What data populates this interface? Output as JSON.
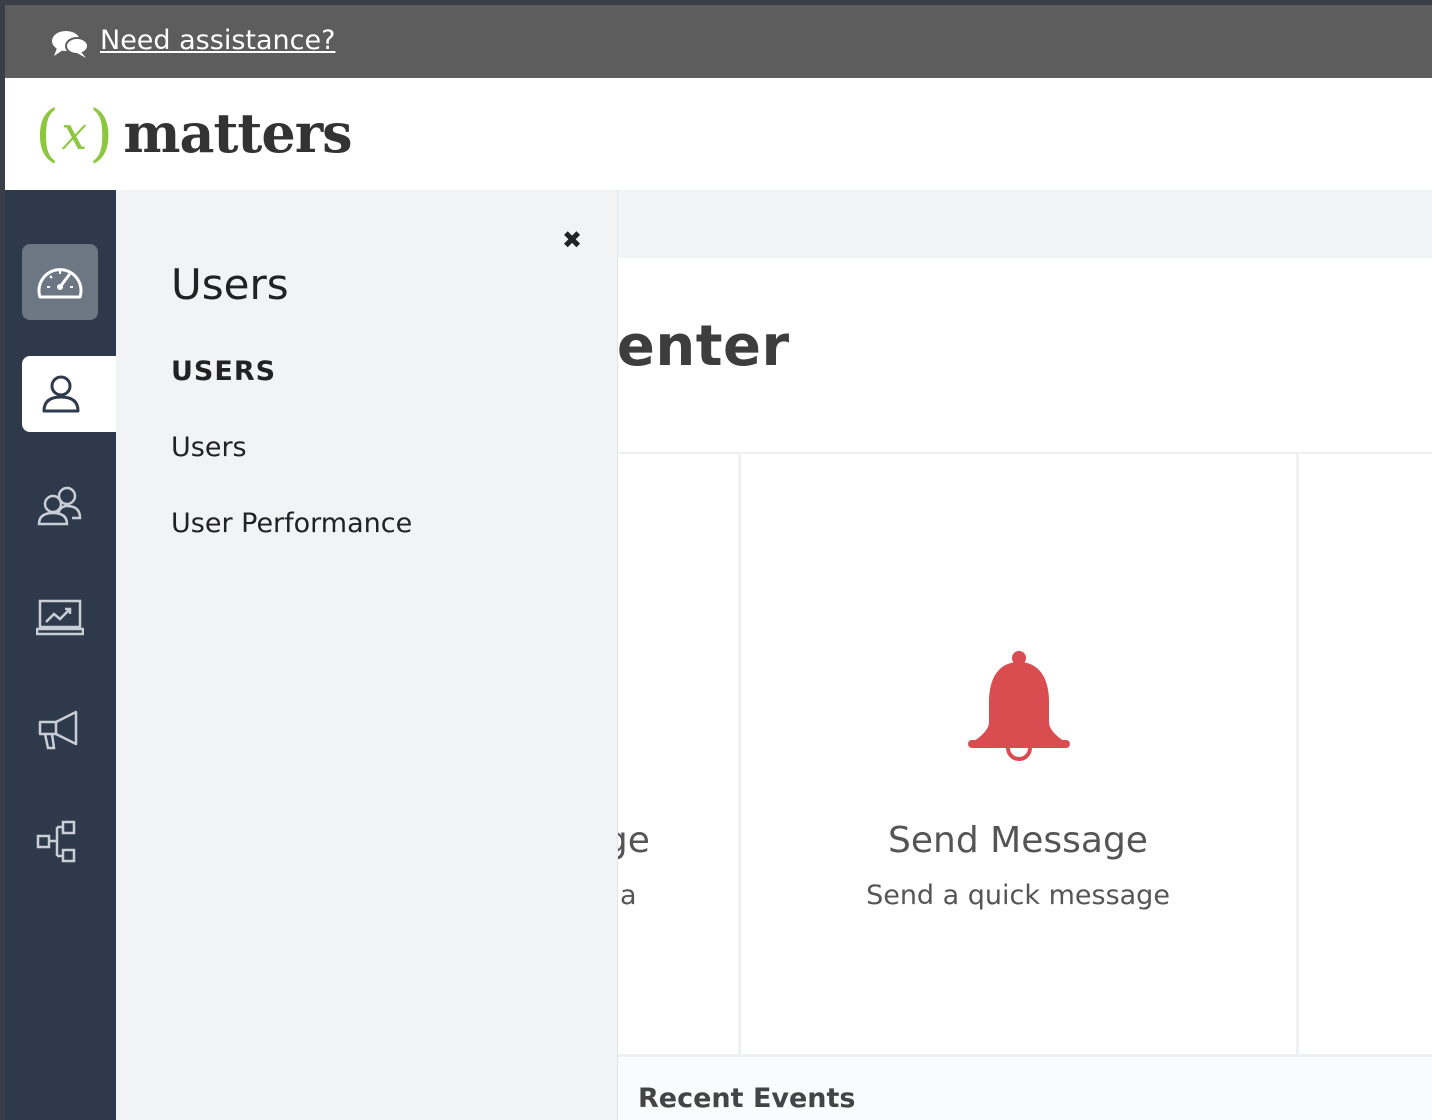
{
  "help_bar": {
    "link_text": "Need assistance?",
    "icon": "chat-bubbles-icon"
  },
  "header": {
    "logo": {
      "paren_open": "(",
      "x": "x",
      "paren_close": ")",
      "word": "matters"
    }
  },
  "sidebar": {
    "items": [
      {
        "name": "dashboard",
        "icon": "speedometer-icon",
        "active": false,
        "highlight": true
      },
      {
        "name": "users",
        "icon": "user-icon",
        "active": true
      },
      {
        "name": "groups",
        "icon": "group-icon",
        "active": false
      },
      {
        "name": "reports",
        "icon": "chart-screen-icon",
        "active": false
      },
      {
        "name": "messaging",
        "icon": "megaphone-icon",
        "active": false
      },
      {
        "name": "workflows",
        "icon": "hierarchy-icon",
        "active": false
      }
    ]
  },
  "flyout": {
    "title": "Users",
    "section_label": "USERS",
    "links": [
      "Users",
      "User Performance"
    ],
    "close_icon": "close-icon"
  },
  "main": {
    "page_title_partial": "on Center",
    "cards": [
      {
        "title_partial": "dge",
        "desc_partial": "a"
      },
      {
        "title": "Send Message",
        "desc": "Send a quick message",
        "icon": "bell-icon"
      }
    ],
    "recent_events_label": "Recent Events"
  },
  "colors": {
    "accent_green": "#8dc63f",
    "sidebar_bg": "#2e3a4b",
    "bell_red": "#d94c4f",
    "help_bar": "#5d5d5d"
  }
}
